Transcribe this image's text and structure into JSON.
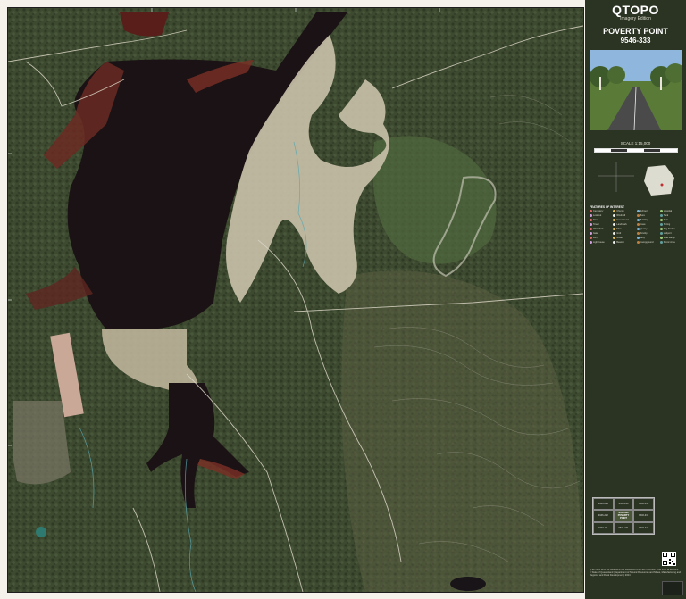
{
  "brand": {
    "title": "QTOPO",
    "subtitle": "Imagery Edition"
  },
  "sheet": {
    "name": "POVERTY POINT",
    "number": "9546-333"
  },
  "scale": {
    "text": "SCALE 1:15,000"
  },
  "legend": {
    "heading": "FEATURES OF INTEREST",
    "items": [
      "Cemetery",
      "Church",
      "School",
      "Hospital",
      "Lookout",
      "Windmill",
      "Bore",
      "Tank",
      "Dam",
      "Homestead",
      "Building",
      "Ruin",
      "Tower",
      "Landmark",
      "Cave",
      "Spring",
      "Waterhole",
      "Mine",
      "Quarry",
      "Trig Station",
      "Gate",
      "Grid",
      "Airstrip",
      "Heliport",
      "Ferry",
      "Wharf",
      "Jetty",
      "Boat Ramp",
      "Lighthouse",
      "Beacon",
      "Campground",
      "Picnic Area"
    ],
    "colors": [
      "#e06a6a",
      "#e8c05a",
      "#7ab8e0",
      "#9ccc7a",
      "#d0a0e0",
      "#f0f0f0",
      "#c08040",
      "#60a0a0"
    ]
  },
  "index": {
    "cells": [
      "9446-224",
      "9546-224",
      "9546-144",
      "9446-222",
      "9546-333 POVERTY POINT",
      "9546-332",
      "9446-111",
      "9546-441",
      "9546-442"
    ],
    "center_index": 4
  },
  "footer": {
    "lines": [
      "THIS MAP MAY BE PRINTED OR REPRODUCED BY ANYONE FOR ANY PURPOSE",
      "© State of Queensland (Department of Natural Resources and Mines, Manufacturing and Regional and Rural Development) 2024"
    ]
  },
  "map": {
    "water_color": "#1a1214",
    "mud_color": "#6b2a22",
    "sand_color": "#c8bfa8",
    "forest_color": "#3f4d30"
  }
}
